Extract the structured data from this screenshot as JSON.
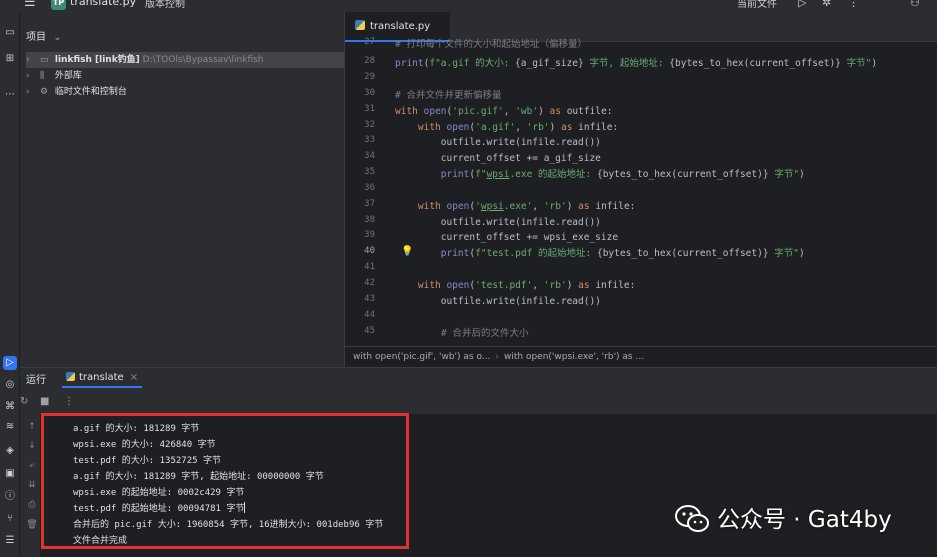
{
  "titlebar": {
    "project_badge": "TP",
    "project_name": "translate.py",
    "vcs_label": "版本控制",
    "run_config": "当前文件"
  },
  "project_panel": {
    "title": "项目",
    "items": [
      {
        "label": "linkfish [link钓鱼]",
        "path": "D:\\TOOls\\Bypassav\\linkfish"
      },
      {
        "label": "外部库",
        "path": ""
      },
      {
        "label": "临时文件和控制台",
        "path": ""
      }
    ]
  },
  "editor": {
    "tab_label": "translate.py",
    "lines": [
      {
        "n": "27",
        "text": "# 打印每个文件的大小和起始地址（偏移量）"
      },
      {
        "n": "28",
        "text": ""
      },
      {
        "n": "29",
        "text": ""
      },
      {
        "n": "30",
        "text": "# 合并文件并更新偏移量"
      },
      {
        "n": "31",
        "text": ""
      },
      {
        "n": "32",
        "text": ""
      },
      {
        "n": "33",
        "text": ""
      },
      {
        "n": "34",
        "text": ""
      },
      {
        "n": "35",
        "text": ""
      },
      {
        "n": "36",
        "text": ""
      },
      {
        "n": "37",
        "text": ""
      },
      {
        "n": "38",
        "text": ""
      },
      {
        "n": "39",
        "text": ""
      },
      {
        "n": "40",
        "text": ""
      },
      {
        "n": "41",
        "text": ""
      },
      {
        "n": "42",
        "text": ""
      },
      {
        "n": "43",
        "text": ""
      },
      {
        "n": "44",
        "text": ""
      },
      {
        "n": "45",
        "text": "# 合并后的文件大小"
      }
    ],
    "breadcrumbs": [
      "with open('pic.gif', 'wb') as o...",
      "with open('wpsi.exe', 'rb') as ..."
    ]
  },
  "run_panel": {
    "title": "运行",
    "tab_label": "translate",
    "output": [
      "a.gif 的大小: 181289 字节",
      "wpsi.exe 的大小: 426840 字节",
      "test.pdf 的大小: 1352725 字节",
      "a.gif 的大小: 181289 字节, 起始地址: 00000000 字节",
      "wpsi.exe 的起始地址: 0002c429 字节",
      "test.pdf 的起始地址: 00094781 字节",
      "合并后的 pic.gif 大小: 1960854 字节, 16进制大小: 001deb96 字节",
      "文件合并完成"
    ]
  },
  "watermark": {
    "text": "公众号 · Gat4by"
  }
}
